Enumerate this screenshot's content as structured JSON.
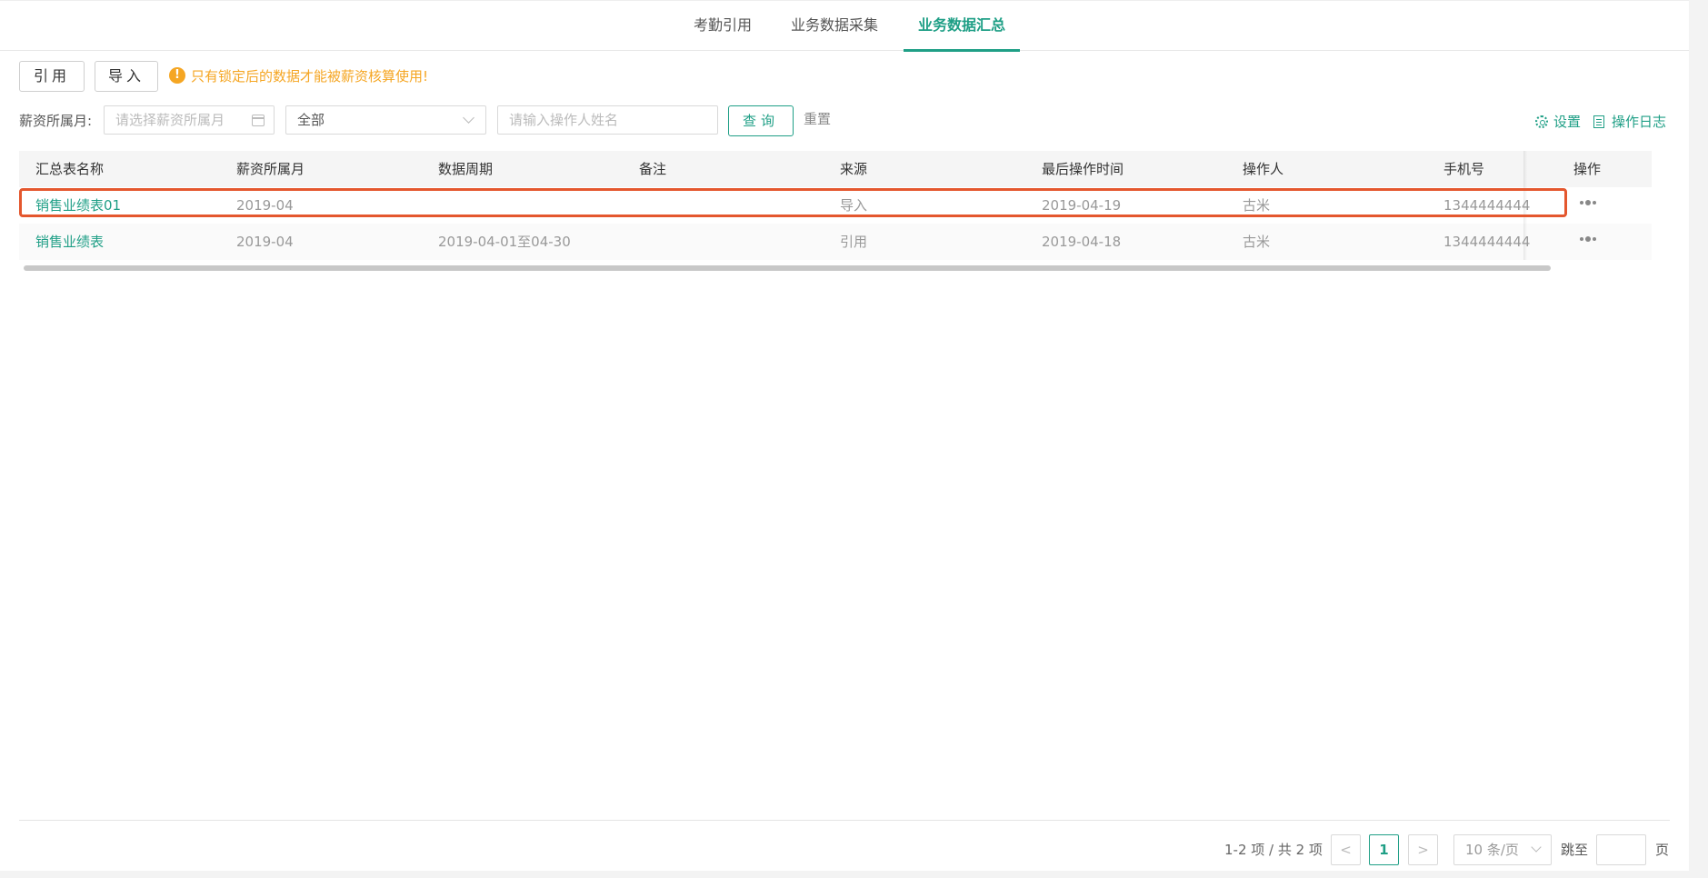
{
  "tabs": [
    {
      "label": "考勤引用"
    },
    {
      "label": "业务数据采集"
    },
    {
      "label": "业务数据汇总"
    }
  ],
  "active_tab": "业务数据汇总",
  "toolbar": {
    "ref_label": "引用",
    "import_label": "导入",
    "notice_icon": "!",
    "notice": "只有锁定后的数据才能被薪资核算使用!"
  },
  "filter": {
    "month_label": "薪资所属月:",
    "month_placeholder": "请选择薪资所属月",
    "scope_value": "全部",
    "name_placeholder": "请输入操作人姓名",
    "query_label": "查询",
    "reset_label": "重置"
  },
  "actions": {
    "settings_label": "设置",
    "log_label": "操作日志"
  },
  "table": {
    "columns": [
      "汇总表名称",
      "薪资所属月",
      "数据周期",
      "备注",
      "来源",
      "最后操作时间",
      "操作人",
      "手机号",
      "操作"
    ],
    "rows": [
      {
        "name": "销售业绩表01",
        "month": "2019-04",
        "period": "",
        "remark": "",
        "source": "导入",
        "time": "2019-04-19",
        "operator": "古米",
        "phone": "1344444444"
      },
      {
        "name": "销售业绩表",
        "month": "2019-04",
        "period": "2019-04-01至04-30",
        "remark": "",
        "source": "引用",
        "time": "2019-04-18",
        "operator": "古米",
        "phone": "1344444444"
      }
    ]
  },
  "pagination": {
    "total_text": "1-2 项 / 共 2 项",
    "prev": "<",
    "current": "1",
    "next": ">",
    "page_size": "10 条/页",
    "jump_label": "跳至",
    "page_unit": "页"
  },
  "colors": {
    "accent": "#1f9f86",
    "warning": "#f5a623",
    "highlight": "#e4572e"
  }
}
